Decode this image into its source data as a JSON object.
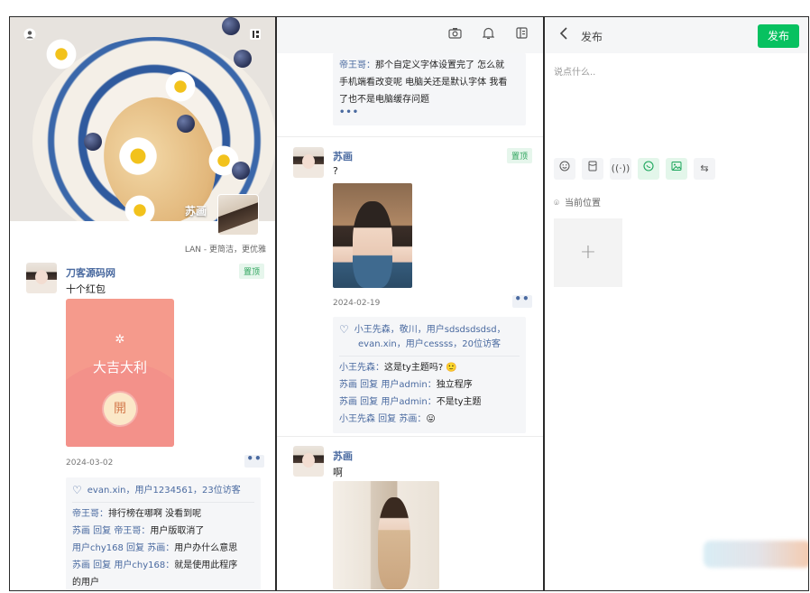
{
  "panel1": {
    "hero_name": "苏画",
    "slogan": "LAN - 更简洁，更优雅",
    "post": {
      "user": "刀客源码网",
      "pin": "置顶",
      "text": "十个红包",
      "redpacket": {
        "title": "大吉大利",
        "open": "開"
      },
      "date": "2024-03-02",
      "likes": "evan.xin，用户1234561，23位访客",
      "comments": [
        {
          "who": "帝王哥：",
          "text": "排行榜在哪啊 没看到呢"
        },
        {
          "who": "苏画 回复 帝王哥：",
          "text": "用户版取消了"
        },
        {
          "who": "用户chy168 回复 苏画：",
          "text": "用户办什么意思"
        },
        {
          "who": "苏画 回复 用户chy168：",
          "text": "就是使用此程序"
        },
        {
          "who": "",
          "text": "的用户"
        }
      ]
    }
  },
  "panel2": {
    "top_comment": {
      "who": "帝王哥：",
      "lines": [
        "那个自定义字体设置完了 怎么就",
        "手机端看改变呢 电脑关还是默认字体 我看",
        "了也不是电脑缓存问题"
      ]
    },
    "post1": {
      "user": "苏画",
      "pin": "置顶",
      "text": "?",
      "date": "2024-02-19",
      "likes_line1": "小王先森，敬川，用户sdsdsdsdsd，",
      "likes_line2": "evan.xin，用户cessss，20位访客",
      "comments": [
        {
          "who": "小王先森：",
          "text": "这是ty主题吗? 🙂"
        },
        {
          "who": "苏画 回复 用户admin：",
          "text": "独立程序"
        },
        {
          "who": "苏画 回复 用户admin：",
          "text": "不是ty主题"
        },
        {
          "who": "小王先森 回复 苏画：",
          "text": "😛"
        }
      ]
    },
    "post2": {
      "user": "苏画",
      "text": "啊"
    }
  },
  "panel3": {
    "title": "发布",
    "publish": "发布",
    "placeholder": "说点什么..",
    "location": "当前位置",
    "add": "+"
  },
  "colors": {
    "accent_green": "#07c160",
    "link_blue": "#4a6aa0",
    "redpacket": "#f59a8c"
  }
}
